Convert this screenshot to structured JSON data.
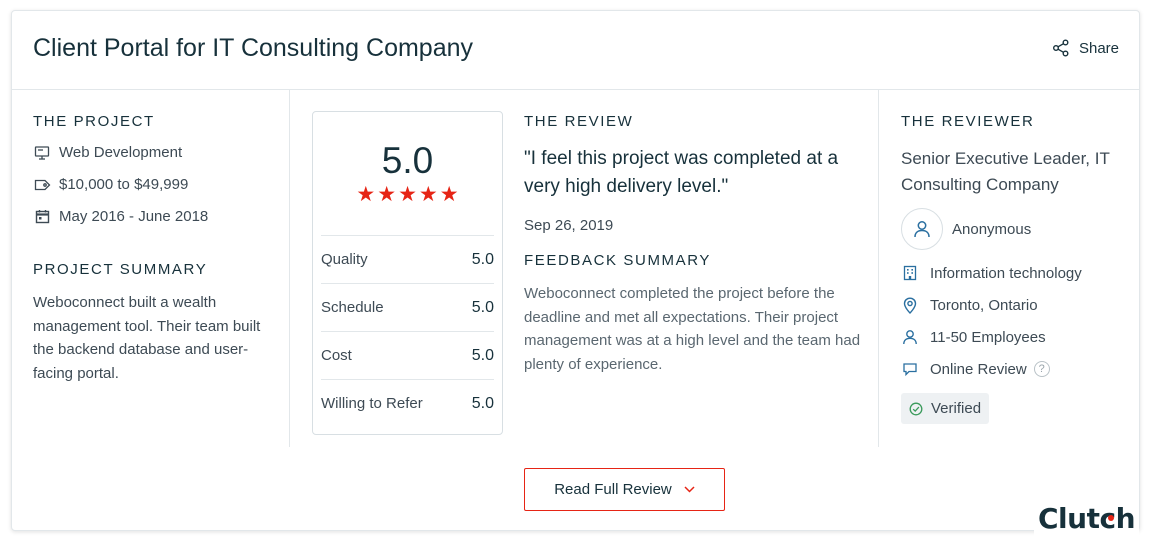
{
  "header": {
    "title": "Client Portal for IT Consulting Company",
    "share_label": "Share"
  },
  "project": {
    "section_title": "THE PROJECT",
    "service": "Web Development",
    "budget": "$10,000 to $49,999",
    "dates": "May 2016 - June 2018",
    "summary_title": "PROJECT SUMMARY",
    "summary_text": "Weboconnect built a wealth management tool. Their team built the backend database and user-facing portal."
  },
  "ratings": {
    "overall": "5.0",
    "stars": 5,
    "rows": [
      {
        "label": "Quality",
        "value": "5.0"
      },
      {
        "label": "Schedule",
        "value": "5.0"
      },
      {
        "label": "Cost",
        "value": "5.0"
      },
      {
        "label": "Willing to Refer",
        "value": "5.0"
      }
    ]
  },
  "review": {
    "section_title": "THE REVIEW",
    "quote": "\"I feel this project was completed at a very high delivery level.\"",
    "date": "Sep 26, 2019",
    "feedback_title": "FEEDBACK SUMMARY",
    "feedback_text": "Weboconnect completed the project before the deadline and met all expectations. Their project management was at a high level and the team had plenty of experience."
  },
  "reviewer": {
    "section_title": "THE REVIEWER",
    "role": "Senior Executive Leader, IT Consulting Company",
    "name": "Anonymous",
    "industry": "Information technology",
    "location": "Toronto, Ontario",
    "size": "11-50 Employees",
    "review_type": "Online Review",
    "help_glyph": "?",
    "verified_label": "Verified"
  },
  "actions": {
    "read_full_label": "Read Full Review"
  },
  "brand": {
    "logo_text": "Clutch",
    "accent_color": "#e62415",
    "text_color": "#17313b"
  }
}
